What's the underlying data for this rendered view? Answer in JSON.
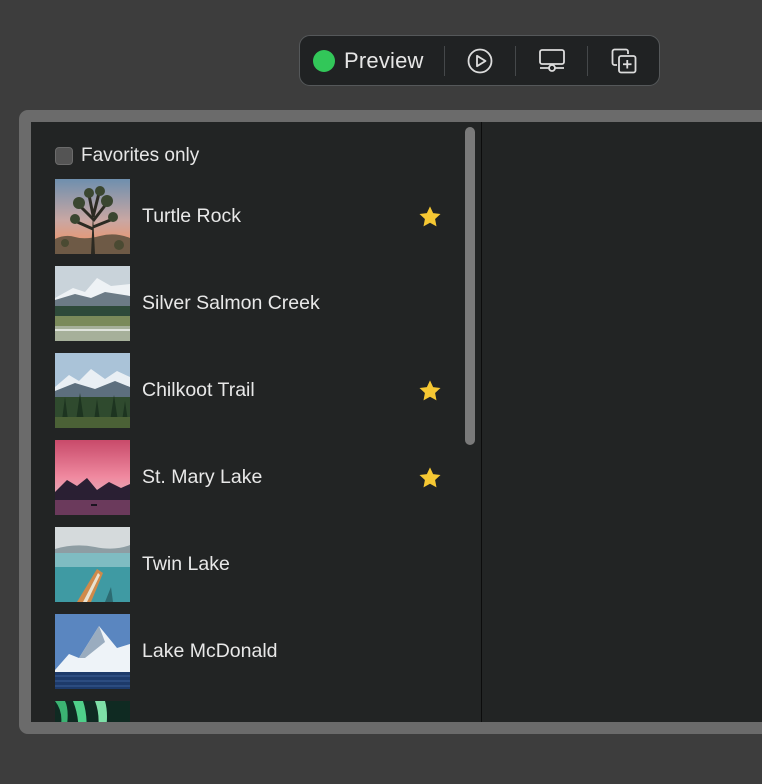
{
  "toolbar": {
    "preview_label": "Preview",
    "status_color": "#32c759",
    "buttons": [
      {
        "icon": "play-circle-icon"
      },
      {
        "icon": "device-settings-icon"
      },
      {
        "icon": "duplicate-icon"
      }
    ]
  },
  "sidebar": {
    "favorites_toggle": {
      "label": "Favorites only",
      "checked": false
    },
    "landmarks": [
      {
        "name": "Turtle Rock",
        "favorite": true,
        "thumbnail": "joshua-tree-sunset"
      },
      {
        "name": "Silver Salmon Creek",
        "favorite": false,
        "thumbnail": "snowy-mountain-meadow"
      },
      {
        "name": "Chilkoot Trail",
        "favorite": true,
        "thumbnail": "mountain-forest"
      },
      {
        "name": "St. Mary Lake",
        "favorite": true,
        "thumbnail": "pink-sunset-lake"
      },
      {
        "name": "Twin Lake",
        "favorite": false,
        "thumbnail": "kayak-lake"
      },
      {
        "name": "Lake McDonald",
        "favorite": false,
        "thumbnail": "snow-peak-lake"
      },
      {
        "name": "",
        "favorite": false,
        "thumbnail": "aurora"
      }
    ]
  },
  "colors": {
    "star": "#f6c833",
    "background": "#3d3d3d",
    "panel": "#222424"
  }
}
